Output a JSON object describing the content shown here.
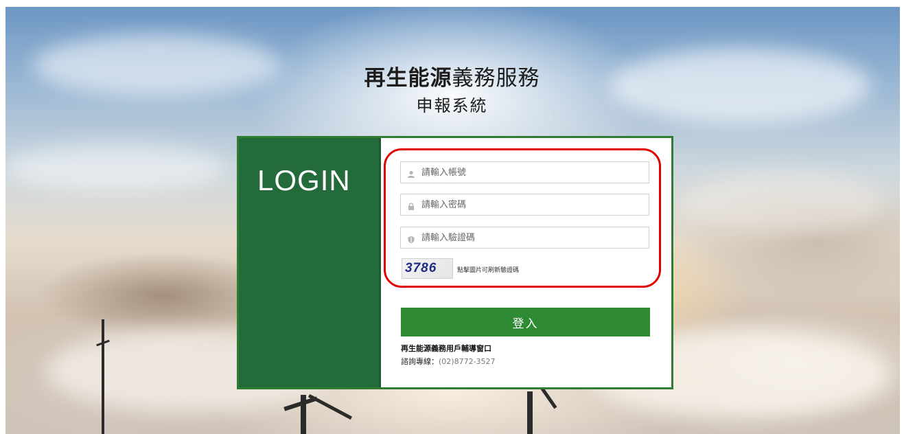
{
  "header": {
    "title_bold": "再生能源",
    "title_light": "義務服務",
    "subtitle": "申報系統"
  },
  "login": {
    "panel_label": "LOGIN",
    "account": {
      "placeholder": "請輸入帳號",
      "value": ""
    },
    "password": {
      "placeholder": "請輸入密碼",
      "value": ""
    },
    "captcha": {
      "placeholder": "請輸入驗證碼",
      "value": "",
      "image_text": "3786",
      "hint": "點擊圖片可刷新驗證碼"
    },
    "submit_label": "登入"
  },
  "help": {
    "title": "再生能源義務用戶輔導窗口",
    "phone_label": "諮詢專線：",
    "phone_number": "(02)8772-3527"
  },
  "colors": {
    "panel_green": "#236b3a",
    "button_green": "#2f8a34",
    "highlight_red": "#e00000"
  },
  "icons": [
    "user-icon",
    "lock-icon",
    "shield-icon"
  ]
}
